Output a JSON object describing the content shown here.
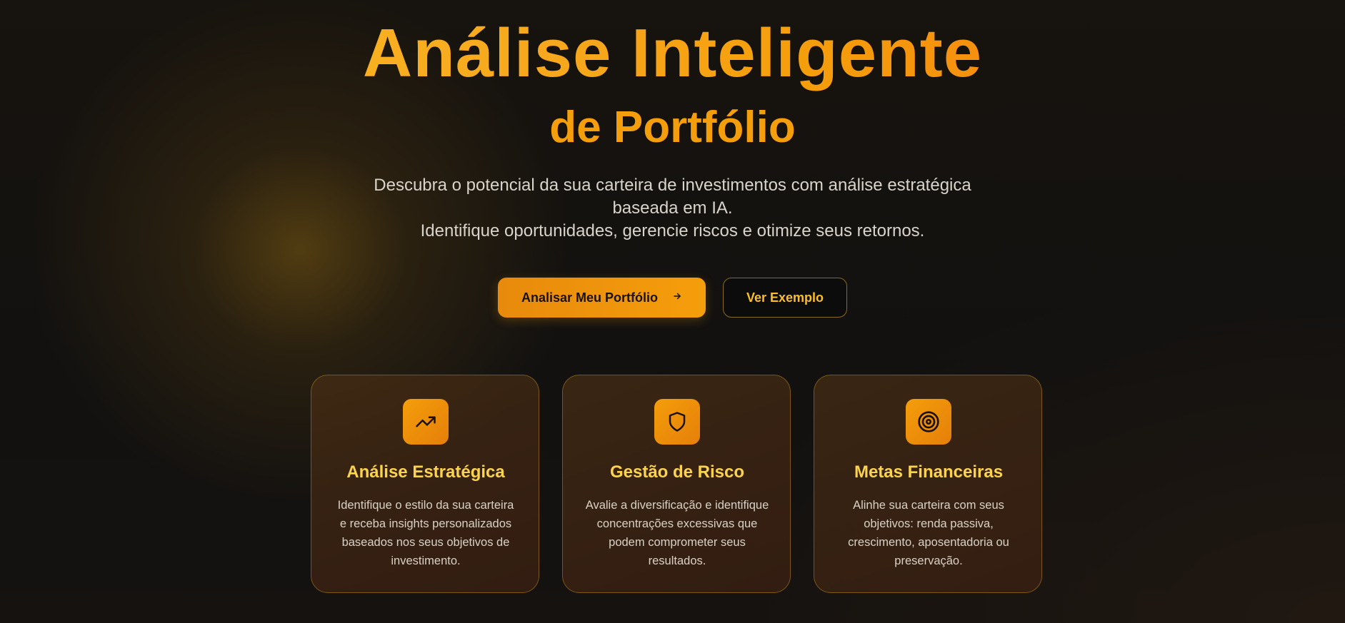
{
  "hero": {
    "title": "Análise Inteligente",
    "subtitle": "de Portfólio",
    "description_line1": "Descubra o potencial da sua carteira de investimentos com análise estratégica",
    "description_line2": "baseada em IA.",
    "description_line3": "Identifique oportunidades, gerencie riscos e otimize seus retornos."
  },
  "cta": {
    "primary_label": "Analisar Meu Portfólio",
    "primary_icon": "arrow-right-icon",
    "secondary_label": "Ver Exemplo"
  },
  "colors": {
    "accent": "#f59e0b",
    "accent_light": "#fbbf24",
    "card_title": "#fcd34d",
    "background": "#121110"
  },
  "features": [
    {
      "icon": "trending-up-icon",
      "title": "Análise Estratégica",
      "text": "Identifique o estilo da sua carteira e receba insights personalizados baseados nos seus objetivos de investimento."
    },
    {
      "icon": "shield-icon",
      "title": "Gestão de Risco",
      "text": "Avalie a diversificação e identifique concentrações excessivas que podem comprometer seus resultados."
    },
    {
      "icon": "target-icon",
      "title": "Metas Financeiras",
      "text": "Alinhe sua carteira com seus objetivos: renda passiva, crescimento, aposentadoria ou preservação."
    }
  ]
}
